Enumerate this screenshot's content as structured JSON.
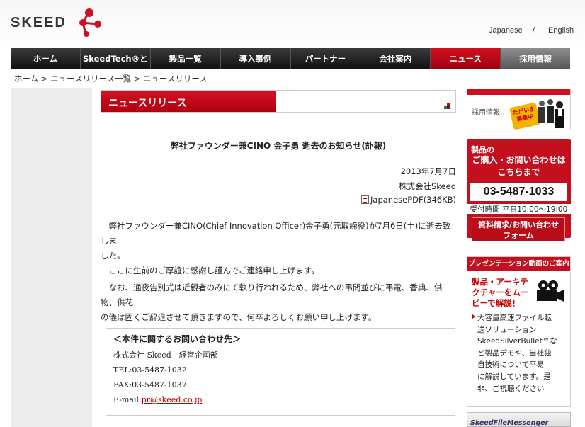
{
  "header": {
    "logo_text": "SKEED",
    "lang": {
      "japanese": "Japanese",
      "separator": "/",
      "english": "English"
    }
  },
  "nav": {
    "items": [
      {
        "label": "ホーム"
      },
      {
        "label": "SkeedTech®とは"
      },
      {
        "label": "製品一覧"
      },
      {
        "label": "導入事例"
      },
      {
        "label": "パートナー"
      },
      {
        "label": "会社案内"
      },
      {
        "label": "ニュース",
        "active": true
      },
      {
        "label": "採用情報"
      }
    ]
  },
  "breadcrumb": "ホーム > ニュースリリース一覧 > ニュースリリース",
  "section": {
    "title": "ニュースリリース"
  },
  "article": {
    "title": "弊社ファウンダー兼CINO 金子勇 逝去のお知らせ(訃報)",
    "date": "2013年7月7日",
    "company": "株式会社Skeed",
    "pdf_label": "JapanesePDF(346KB)",
    "para1_line1": "　弊社ファウンダー兼CINO(Chief Innovation Officer)金子勇(元取締役)が7月6日(土)に逝去致しま",
    "para1_line2": "した。",
    "para1_line3": "　ここに生前のご厚誼に感謝し謹んでご連絡申し上げます。",
    "para2_line1": "　なお、通夜告別式は近親者のみにて執り行われるため、弊社への弔問並びに弔電、香典、供物、供花",
    "para2_line2": "の儀は固くご辞退させて頂きますので、何卒よろしくお願い申し上げます。"
  },
  "contact": {
    "heading": "＜本件に関するお問い合わせ先＞",
    "company": "株式会社 Skeed　経営企画部",
    "tel": "TEL:03-5487-1032",
    "fax": "FAX:03-5487-1037",
    "email_label": "E-mail:",
    "email": "pr@skeed.co.jp"
  },
  "sidebar": {
    "recruit": {
      "label": "採用情報",
      "badge": "ただいま募集中"
    },
    "inquiry": {
      "line1": "製品の",
      "line2": "ご購入・お問い合わせは",
      "line3": "こちらまで",
      "tel": "03-5487-1033",
      "hours": "受付時間:平日10:00～19:00",
      "button_line1": "資料請求/お問い合わせ",
      "button_line2": "フォーム"
    },
    "presentation": {
      "heading": "プレゼンテーション動画のご案内",
      "title_line1": "製品・アーキテ",
      "title_line2": "クチャーをムー",
      "title_line3": "ビーで解説！",
      "desc_line1": "大容量高速ファイル転",
      "desc_line2": "送ソリューション",
      "desc_line3": "SkeedSilverBullet™な",
      "desc_line4": "ど製品デモや、当社独",
      "desc_line5": "自技術について平易",
      "desc_line6": "に解説しています。是",
      "desc_line7": "非、ご視聴ください"
    },
    "banner": "SkeedFileMessenger"
  },
  "colors": {
    "accent": "#c4101e",
    "nav_dark": "#1a1a1a"
  },
  "icons": {
    "pdf": "pdf-file-icon",
    "camera": "video-camera-icon",
    "logo_mark": "molecule-logo-icon"
  }
}
